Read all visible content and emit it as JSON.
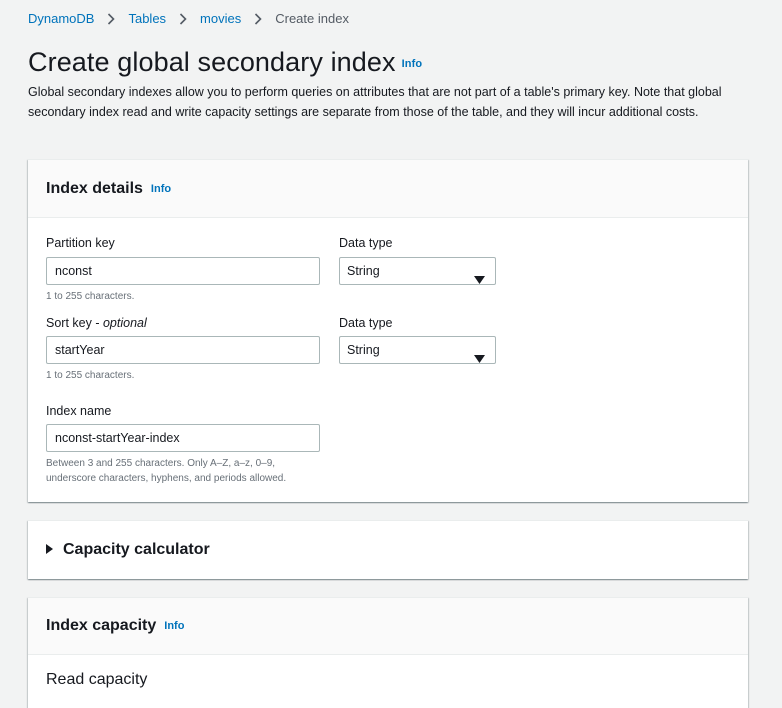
{
  "breadcrumb": {
    "items": [
      "DynamoDB",
      "Tables",
      "movies"
    ],
    "current": "Create index"
  },
  "page": {
    "title": "Create global secondary index",
    "info": "Info",
    "description": "Global secondary indexes allow you to perform queries on attributes that are not part of a table's primary key. Note that global secondary index read and write capacity settings are separate from those of the table, and they will incur additional costs."
  },
  "index_details": {
    "title": "Index details",
    "info": "Info",
    "partition_key": {
      "label": "Partition key",
      "value": "nconst",
      "hint": "1 to 255 characters.",
      "type_label": "Data type",
      "type_value": "String"
    },
    "sort_key": {
      "label": "Sort key - ",
      "label_optional": "optional",
      "value": "startYear",
      "hint": "1 to 255 characters.",
      "type_label": "Data type",
      "type_value": "String"
    },
    "index_name": {
      "label": "Index name",
      "value": "nconst-startYear-index",
      "hint_line1": "Between 3 and 255 characters. Only A–Z, a–z, 0–9,",
      "hint_line2": "underscore characters, hyphens, and periods allowed."
    }
  },
  "capacity_calculator": {
    "title": "Capacity calculator",
    "icon": "caret-right-icon"
  },
  "index_capacity": {
    "title": "Index capacity",
    "info": "Info",
    "read_capacity": "Read capacity"
  },
  "colors": {
    "link": "#0073bb",
    "background": "#f2f3f3",
    "text": "#16191f",
    "hint": "#687078"
  }
}
